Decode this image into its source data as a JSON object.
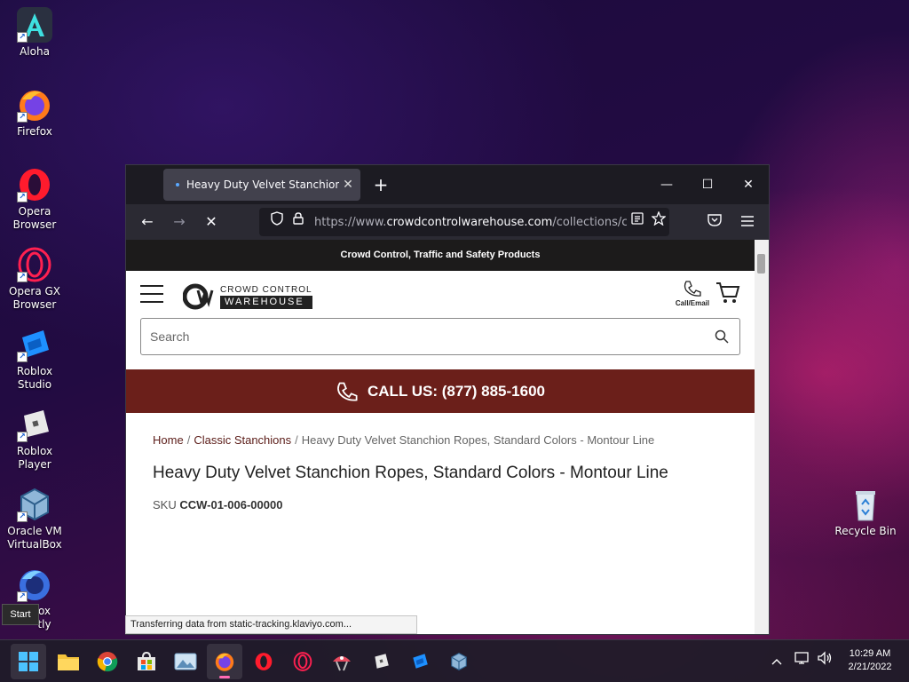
{
  "desktop": {
    "icons": [
      {
        "label": "Aloha",
        "icon": "aloha-icon"
      },
      {
        "label": "Firefox",
        "icon": "firefox-icon"
      },
      {
        "label": "Opera Browser",
        "icon": "opera-icon"
      },
      {
        "label": "Opera GX Browser",
        "icon": "opera-gx-icon"
      },
      {
        "label": "Roblox Studio",
        "icon": "roblox-studio-icon"
      },
      {
        "label": "Roblox Player",
        "icon": "roblox-player-icon"
      },
      {
        "label": "Oracle VM VirtualBox",
        "icon": "virtualbox-icon"
      },
      {
        "label": "ox\ntly",
        "icon": "firefox-nightly-icon"
      }
    ],
    "recycle_bin": "Recycle Bin",
    "tooltip": "Start"
  },
  "browser": {
    "tab_title": "Heavy Duty Velvet Stanchion Ropes, Standard Colors - Montour Line",
    "new_tab": "+",
    "window_controls": {
      "minimize": "—",
      "maximize": "☐",
      "close": "✕"
    },
    "nav": {
      "back": "←",
      "forward": "→",
      "stop": "✕"
    },
    "url_prefix": "https://www.",
    "url_main": "crowdcontrolwarehouse.com",
    "url_rest": "/collections/classic-stanchions",
    "status": "Transferring data from static-tracking.klaviyo.com..."
  },
  "site": {
    "announcement": "Crowd Control, Traffic and Safety Products",
    "logo_top": "CROWD CONTROL",
    "logo_bottom": "WAREHOUSE",
    "call_email": "Call/Email",
    "search_placeholder": "Search",
    "call_us": "CALL US: (877) 885-1600",
    "breadcrumb": {
      "home": "Home",
      "sep": "/",
      "collection": "Classic Stanchions",
      "current": "Heavy Duty Velvet Stanchion Ropes, Standard Colors - Montour Line"
    },
    "product_title": "Heavy Duty Velvet Stanchion Ropes, Standard Colors - Montour Line",
    "sku_label": "SKU",
    "sku_value": "CCW-01-006-00000"
  },
  "taskbar": {
    "time": "10:29 AM",
    "date": "2/21/2022"
  },
  "colors": {
    "call_bar": "#6b1f1a",
    "link": "#5b1c18",
    "announcement_bg": "#1c1b1b"
  }
}
